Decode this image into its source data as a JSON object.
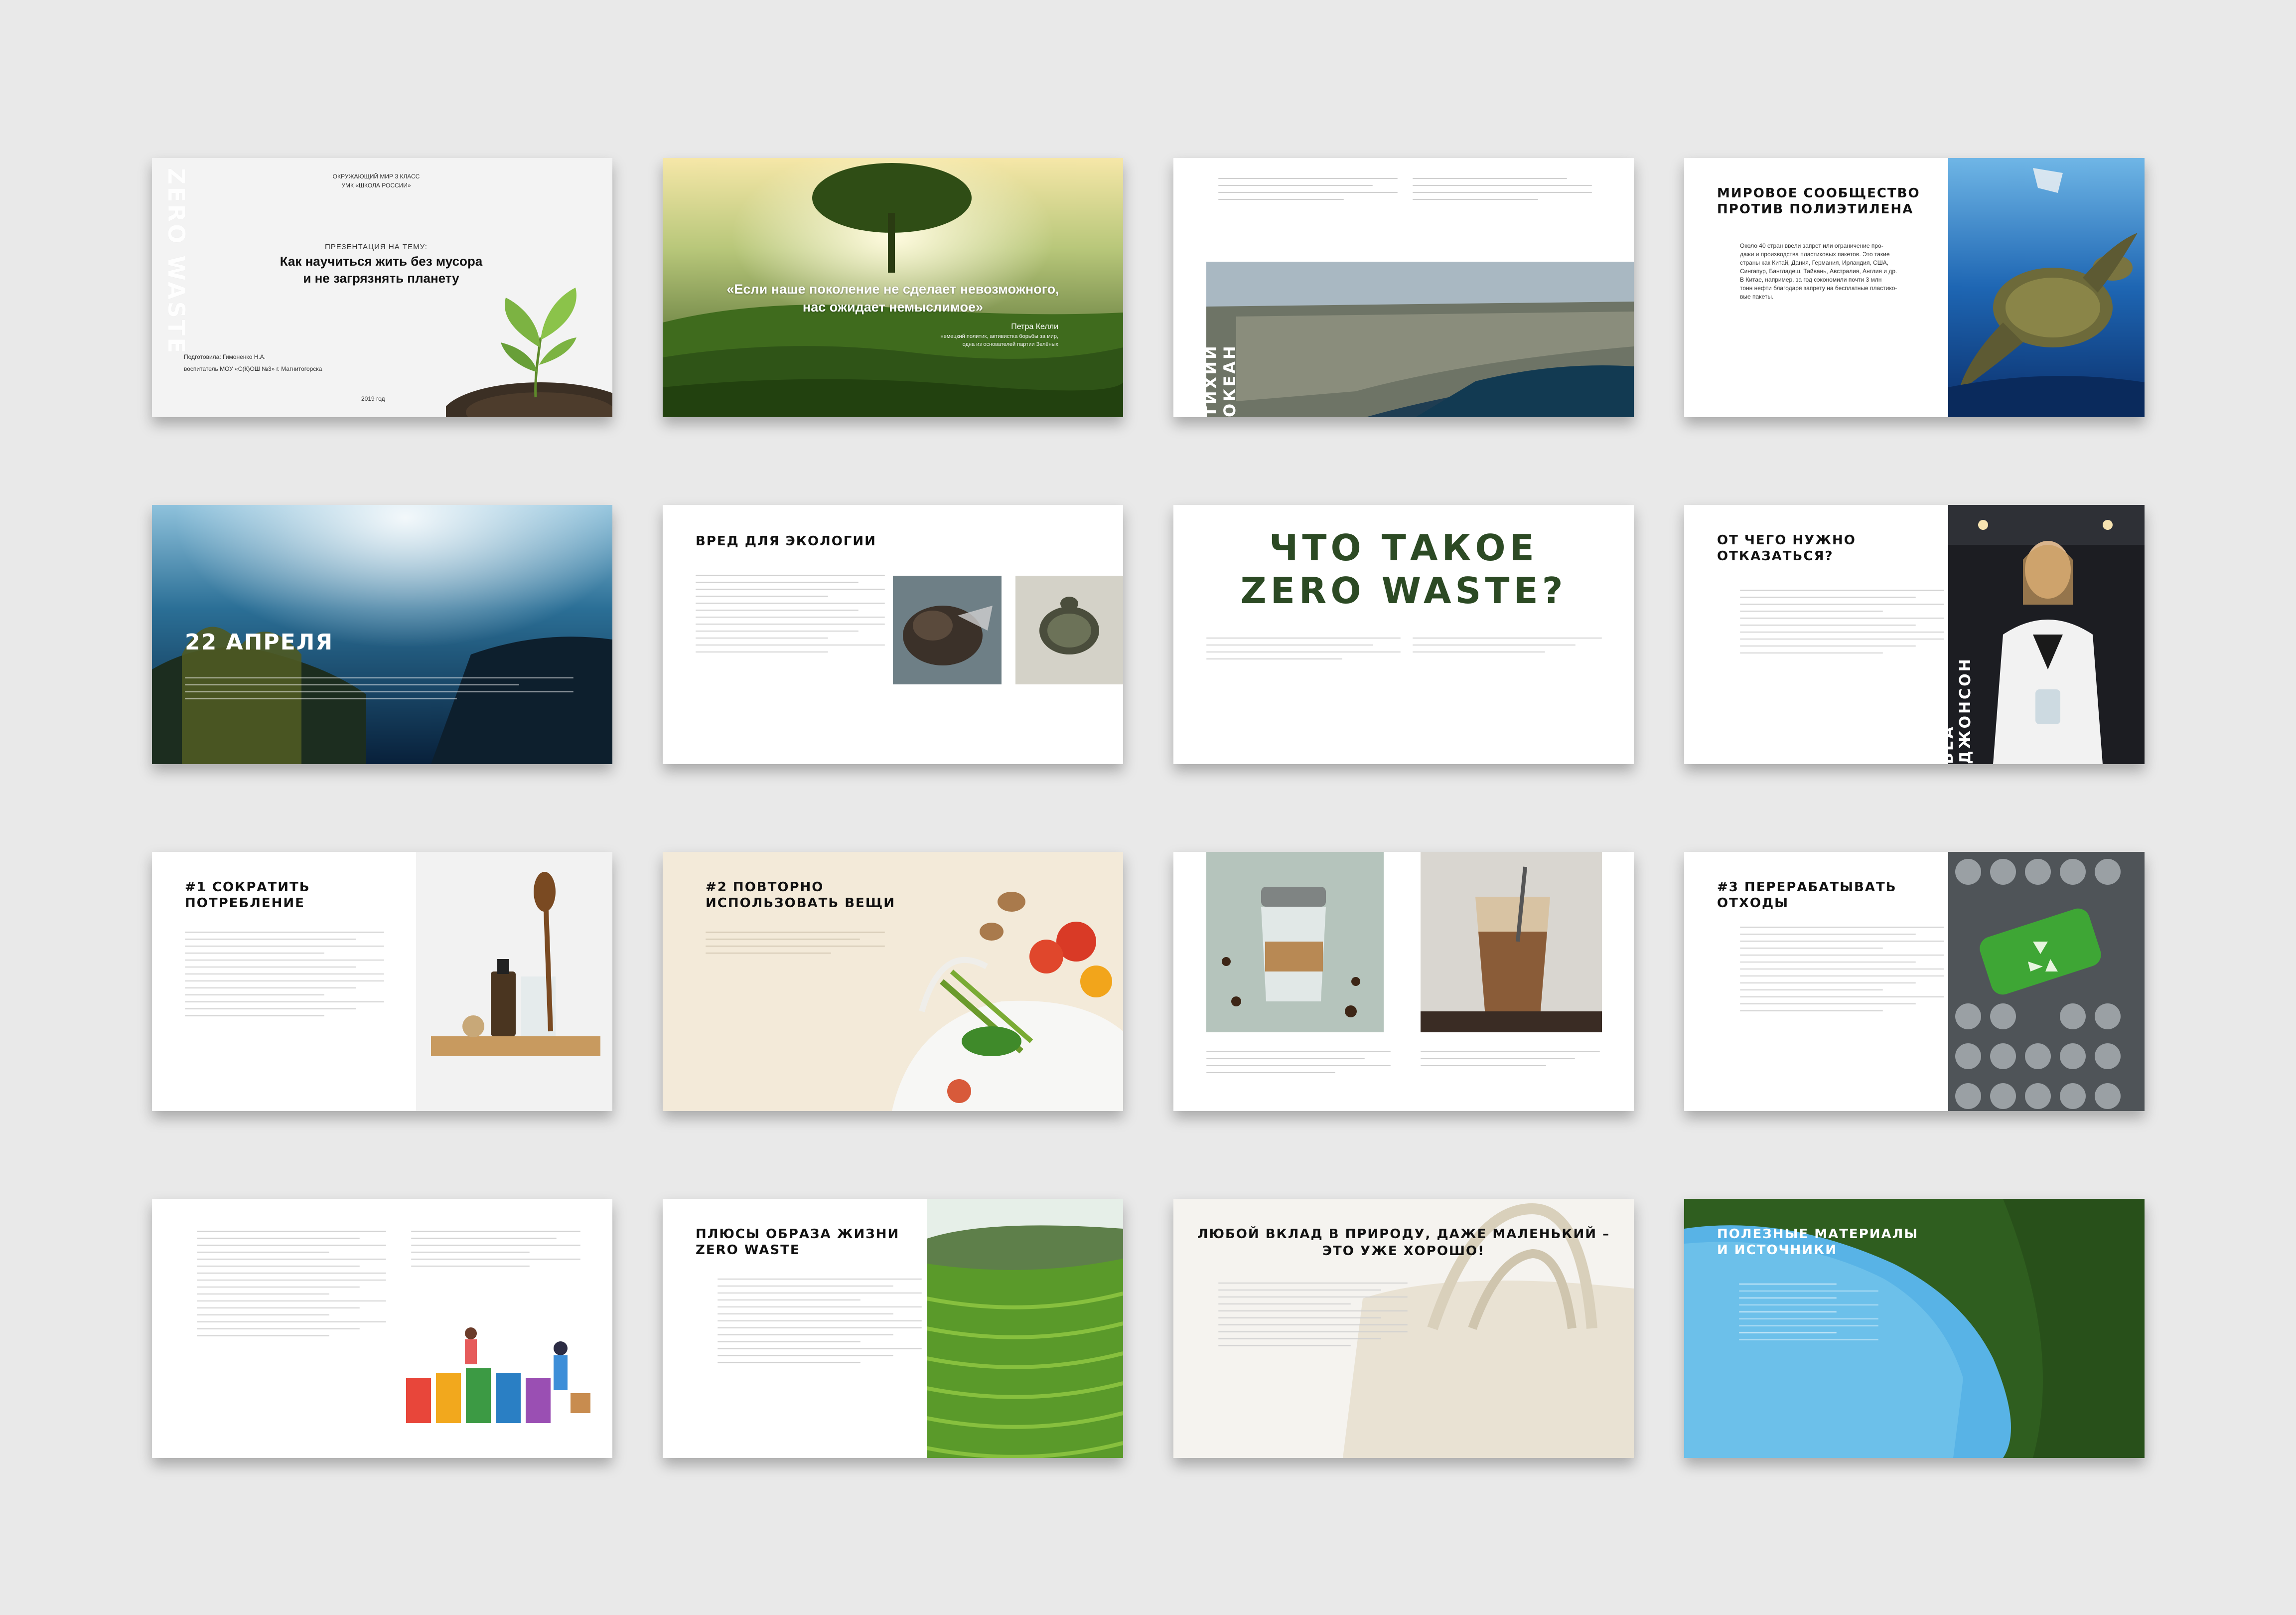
{
  "slides": {
    "s1": {
      "vertical": "ZERO WASTE",
      "subject": "ОКРУЖАЮЩИЙ МИР 3 КЛАСС",
      "program": "УМК «ШКОЛА РОССИИ»",
      "kicker": "ПРЕЗЕНТАЦИЯ НА ТЕМУ:",
      "title1": "Как научиться жить без мусора",
      "title2": "и не загрязнять планету",
      "author1": "Подготовила: Гимоненко Н.А.",
      "author2": "воспитатель МОУ «С(К)ОШ №3» г. Магнитогорска",
      "year": "2019 год"
    },
    "s2": {
      "quote1": "«Если наше поколение не сделает невозможного,",
      "quote2": "нас ожидает немыслимое»",
      "author": "Петра Келли",
      "role1": "немецкий политик, активистка борьбы за мир,",
      "role2": "одна из основателей партии Зелёных"
    },
    "s3": {
      "vertical": "ТИХИЙ ОКЕАН"
    },
    "s4": {
      "title1": "МИРОВОЕ СООБЩЕСТВО",
      "title2": "ПРОТИВ ПОЛИЭТИЛЕНА",
      "text1": "Около 40 стран ввели запрет или ограничение про-",
      "text2": "дажи и производства пластиковых пакетов. Это такие",
      "text3": "страны как Китай, Дания, Германия, Ирландия, США,",
      "text4": "Сингапур, Бангладеш, Тайвань, Австралия, Англия и др.",
      "text5": "В Китае, например, за год сэкономили почти 3 млн",
      "text6": "тонн нефти благодаря запрету на бесплатные пластико-",
      "text7": "вые пакеты."
    },
    "s5": {
      "title": "22 АПРЕЛЯ"
    },
    "s6": {
      "title": "ВРЕД ДЛЯ ЭКОЛОГИИ"
    },
    "s7": {
      "title1": "ЧТО ТАКОЕ",
      "title2": "ZERO WASTE?"
    },
    "s8": {
      "title1": "ОТ ЧЕГО НУЖНО",
      "title2": "ОТКАЗАТЬСЯ?",
      "vertical": "БЕА ДЖОНСОН"
    },
    "s9": {
      "title1": "#1 СОКРАТИТЬ",
      "title2": "ПОТРЕБЛЕНИЕ"
    },
    "s10": {
      "title1": "#2 ПОВТОРНО",
      "title2": "ИСПОЛЬЗОВАТЬ ВЕЩИ"
    },
    "s12": {
      "title1": "#3 ПЕРЕРАБАТЫВАТЬ",
      "title2": "ОТХОДЫ"
    },
    "s14": {
      "title1": "ПЛЮСЫ ОБРАЗА ЖИЗНИ",
      "title2": "ZERO WASTE"
    },
    "s15": {
      "title1": "ЛЮБОЙ ВКЛАД В ПРИРОДУ, ДАЖЕ МАЛЕНЬКИЙ –",
      "title2": "ЭТО УЖЕ ХОРОШО!"
    },
    "s16": {
      "title1": "ПОЛЕЗНЫЕ МАТЕРИАЛЫ",
      "title2": "И ИСТОЧНИКИ"
    }
  },
  "colors": {
    "background": "#e9e9e9",
    "slide": "#ffffff",
    "forest": "#2f5e1f",
    "ocean": "#16407a",
    "lake": "#58b3e6",
    "headline_texture": "#2c4a24"
  }
}
